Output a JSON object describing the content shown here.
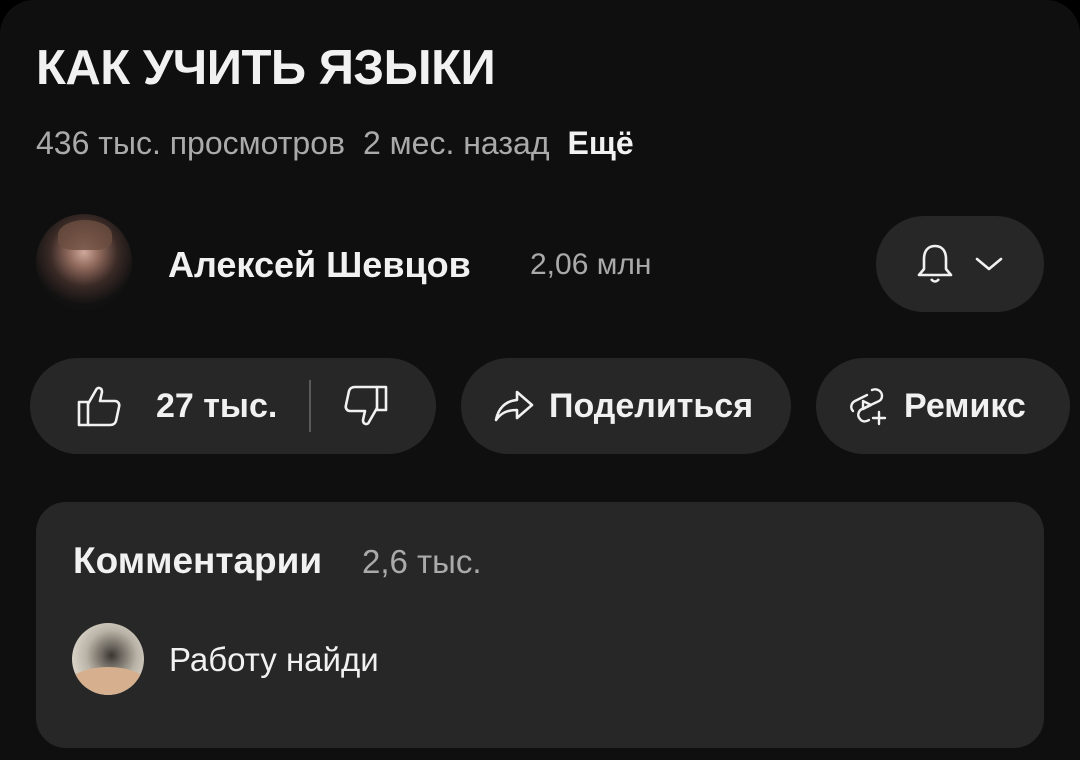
{
  "video": {
    "title": "КАК УЧИТЬ ЯЗЫКИ",
    "views": "436 тыс. просмотров",
    "age": "2 мес. назад",
    "more_label": "Ещё"
  },
  "channel": {
    "name": "Алексей Шевцов",
    "subscribers": "2,06 млн",
    "avatar_icon": "channel-avatar-photo",
    "subscribe_icons": [
      "bell-icon",
      "chevron-down-icon"
    ]
  },
  "actions": {
    "likes": "27 тыс.",
    "like_icon": "thumb-up-icon",
    "dislike_icon": "thumb-down-icon",
    "share_label": "Поделиться",
    "share_icon": "share-arrow-icon",
    "remix_label": "Ремикс",
    "remix_icon": "remix-icon"
  },
  "comments": {
    "title": "Комментарии",
    "count": "2,6 тыс.",
    "top_comment": "Работу найди",
    "avatar_icon": "commenter-avatar-photo"
  },
  "colors": {
    "background": "#0f0f0f",
    "pill": "#272727",
    "primary_text": "#f1f1f1",
    "secondary_text": "#aaaaaa"
  }
}
